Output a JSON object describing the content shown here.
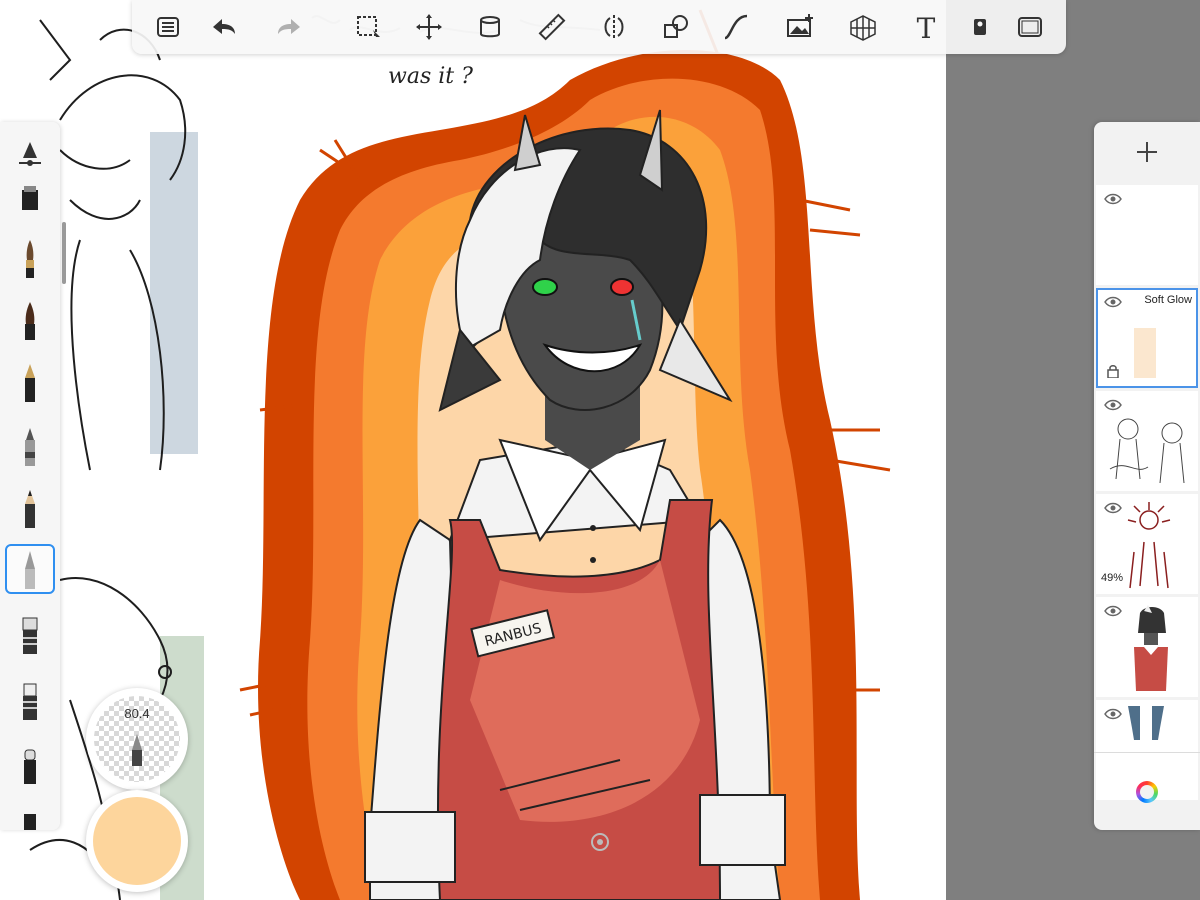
{
  "app": {
    "top_toolbar": [
      "layers-icon",
      "undo-icon",
      "redo-icon",
      "selection-icon",
      "transform-icon",
      "fill-bucket-icon",
      "ruler-icon",
      "symmetry-icon",
      "shape-icon",
      "curve-icon",
      "insert-image-icon",
      "perspective-grid-icon",
      "text-icon",
      "stencil-icon",
      "fullscreen-icon"
    ],
    "brushes": [
      "brush-settings-icon",
      "marker-brush",
      "paintbrush-brush",
      "ink-brush",
      "fountain-pen-brush",
      "airbrush-brush",
      "pencil-brush",
      "soft-airbrush-brush",
      "chisel-marker-brush",
      "flat-marker-brush",
      "round-eraser-brush",
      "square-brush"
    ],
    "selected_brush_index": 7
  },
  "puck": {
    "size_value": "80.4",
    "color": "#fdd59c"
  },
  "layers": {
    "add_label": "+",
    "items": [
      {
        "name": "",
        "opacity": "",
        "selected": false,
        "thumb": "blank"
      },
      {
        "name": "Soft Glow",
        "opacity": "",
        "selected": true,
        "locked": true,
        "thumb": "glow"
      },
      {
        "name": "",
        "opacity": "",
        "selected": false,
        "thumb": "sketch"
      },
      {
        "name": "",
        "opacity": "49%",
        "selected": false,
        "thumb": "red-lines"
      },
      {
        "name": "",
        "opacity": "",
        "selected": false,
        "thumb": "character"
      },
      {
        "name": "",
        "opacity": "",
        "selected": false,
        "thumb": "blue"
      }
    ]
  },
  "canvas": {
    "handwriting": "was it ?",
    "name_tag": "RANBUS",
    "colors": {
      "outer_glow": "#d24400",
      "mid_glow": "#f47a2e",
      "inner_glow": "#fba13a",
      "core_glow": "#fdd6a8",
      "apron": "#c64c45",
      "skin": "#4a4a4a",
      "hair_white": "#f3f3f3",
      "hair_dark": "#2e2e2e"
    }
  },
  "colors": {
    "accent": "#2f8ff0",
    "toolbar_bg": "#f7f7f7",
    "gray_bg": "#7f7f7f"
  }
}
